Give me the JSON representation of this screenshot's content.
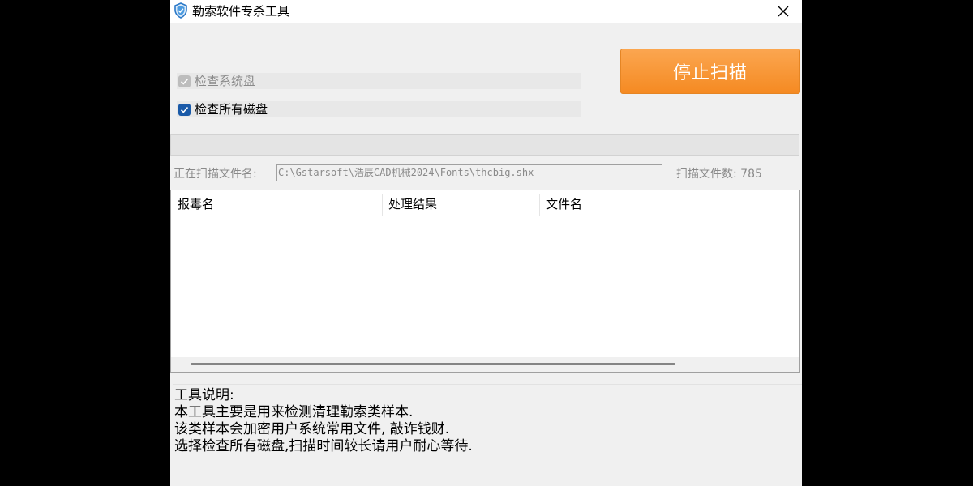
{
  "window": {
    "title": "勒索软件专杀工具",
    "app_icon": "shield-icon",
    "close_icon": "close-icon"
  },
  "options": {
    "check_system_disk": {
      "label": "检查系统盘",
      "checked": true,
      "enabled": false
    },
    "check_all_disks": {
      "label": "检查所有磁盘",
      "checked": true,
      "enabled": true
    }
  },
  "stop_button": {
    "label": "停止扫描",
    "color": "#f7901e"
  },
  "progress": {
    "value": 0
  },
  "scan": {
    "file_label": "正在扫描文件名:",
    "current_file": "C:\\Gstarsoft\\浩辰CAD机械2024\\Fonts\\thcbig.shx",
    "count_label": "扫描文件数: 785"
  },
  "table": {
    "columns": [
      "报毒名",
      "处理结果",
      "文件名"
    ],
    "rows": []
  },
  "description": {
    "lines": [
      "工具说明:",
      "本工具主要是用来检测清理勒索类样本.",
      "该类样本会加密用户系统常用文件, 敲诈钱财.",
      "选择检查所有磁盘,扫描时间较长请用户耐心等待."
    ]
  }
}
